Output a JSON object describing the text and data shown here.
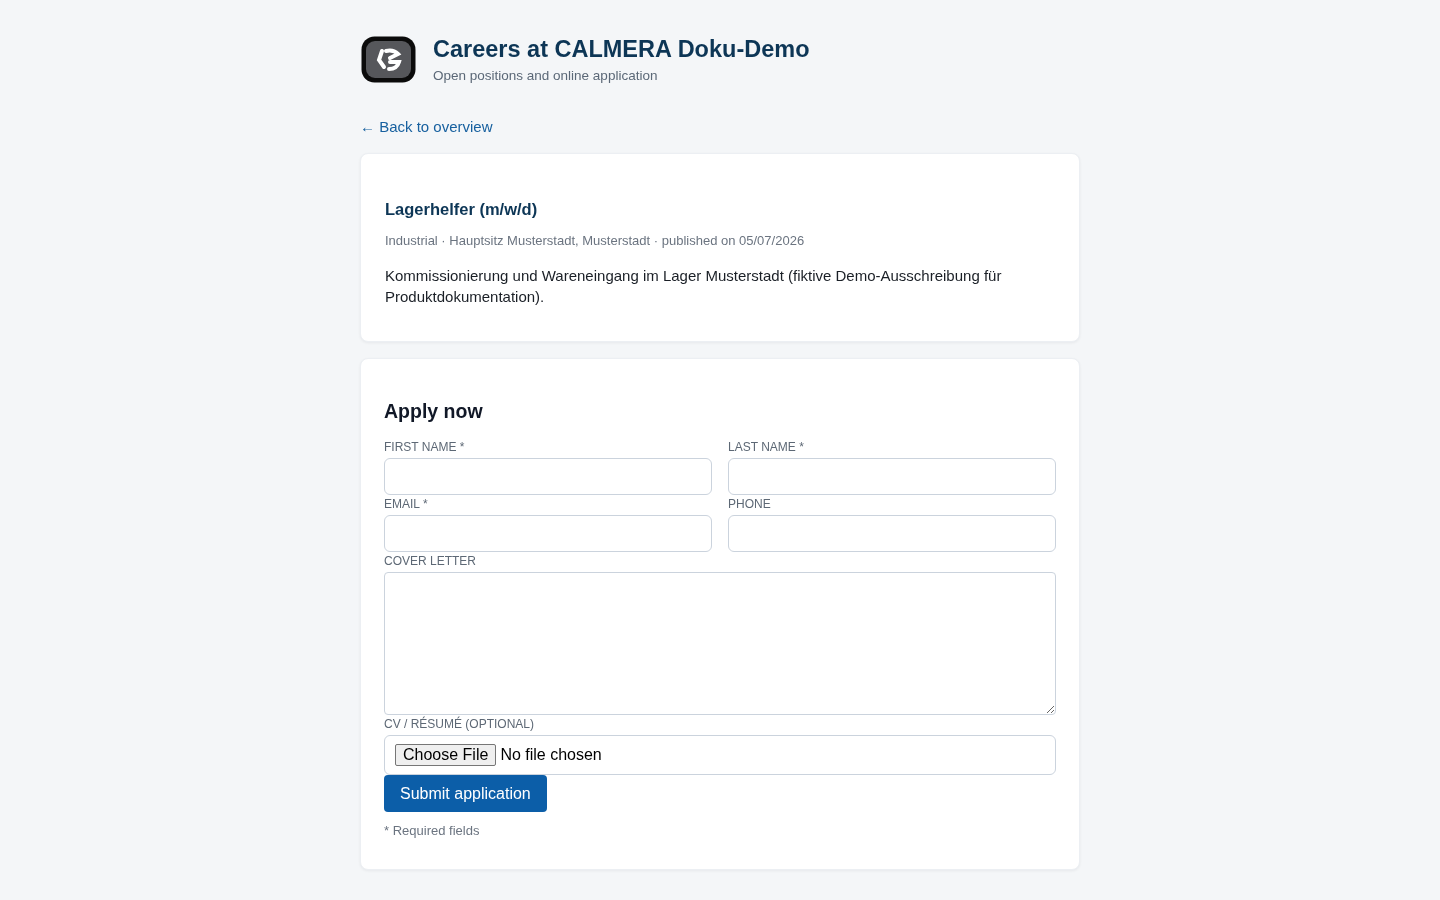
{
  "header": {
    "title": "Careers at CALMERA Doku-Demo",
    "subtitle": "Open positions and online application"
  },
  "back_link": "← Back to overview",
  "job": {
    "title": "Lagerhelfer (m/w/d)",
    "meta": "Industrial · Hauptsitz Musterstadt, Musterstadt · published on 05/07/2026",
    "description": "Kommissionierung und Wareneingang im Lager Musterstadt (fiktive Demo-Ausschreibung für Produktdokumentation)."
  },
  "application_form": {
    "title": "Apply now",
    "fields": [
      {
        "kind": "text",
        "label": "FIRST NAME *"
      },
      {
        "kind": "text",
        "label": "LAST NAME *"
      },
      {
        "kind": "text",
        "label": "EMAIL *"
      },
      {
        "kind": "text",
        "label": "PHONE"
      },
      {
        "kind": "textarea",
        "label": "COVER LETTER"
      },
      {
        "kind": "file",
        "label": "CV / RÉSUMÉ (OPTIONAL)",
        "button_label": "Choose File",
        "status": "No file chosen"
      }
    ],
    "submit_button": "Submit application",
    "note": "* Required fields"
  }
}
